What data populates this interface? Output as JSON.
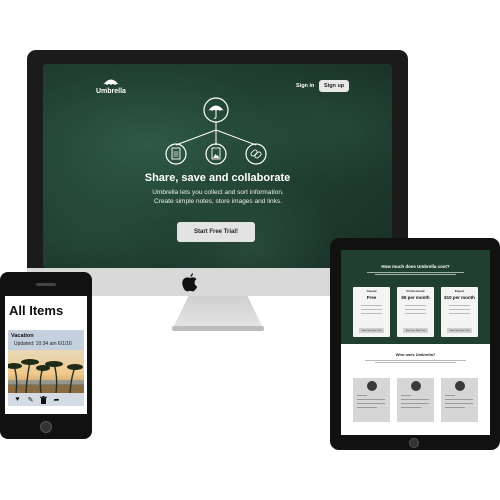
{
  "desktop": {
    "brand": "Umbrella",
    "nav": {
      "signin": "Sign in",
      "signup": "Sign up"
    },
    "hero": {
      "title": "Share, save and collaborate",
      "subtitle": "Umbrella lets you collect and sort information. Create simple notes, store images and links.",
      "cta": "Start Free Trial!"
    },
    "icons": [
      "umbrella-icon",
      "document-icon",
      "image-icon",
      "link-icon"
    ],
    "colors": {
      "screen_bg": "#203f31",
      "cta_bg": "#e3e3e3"
    }
  },
  "phone": {
    "title": "All Items",
    "card": {
      "title": "Vacation",
      "updated": "Updated: 10:34 am 6/1/16"
    },
    "actions": [
      "heart-icon",
      "edit-icon",
      "trash-icon",
      "share-icon"
    ]
  },
  "tablet": {
    "pricing": {
      "title": "How much does Umbrella cost?",
      "plans": [
        {
          "name": "Casual",
          "price": "Free",
          "cta": "Start Your Free Trial"
        },
        {
          "name": "Professional",
          "price": "$5 per month",
          "cta": "Start Your Free Trial"
        },
        {
          "name": "Expert",
          "price": "$10 per month",
          "cta": "Start Your Free Trial"
        }
      ]
    },
    "who": {
      "title": "Who uses Umbrella?"
    }
  }
}
